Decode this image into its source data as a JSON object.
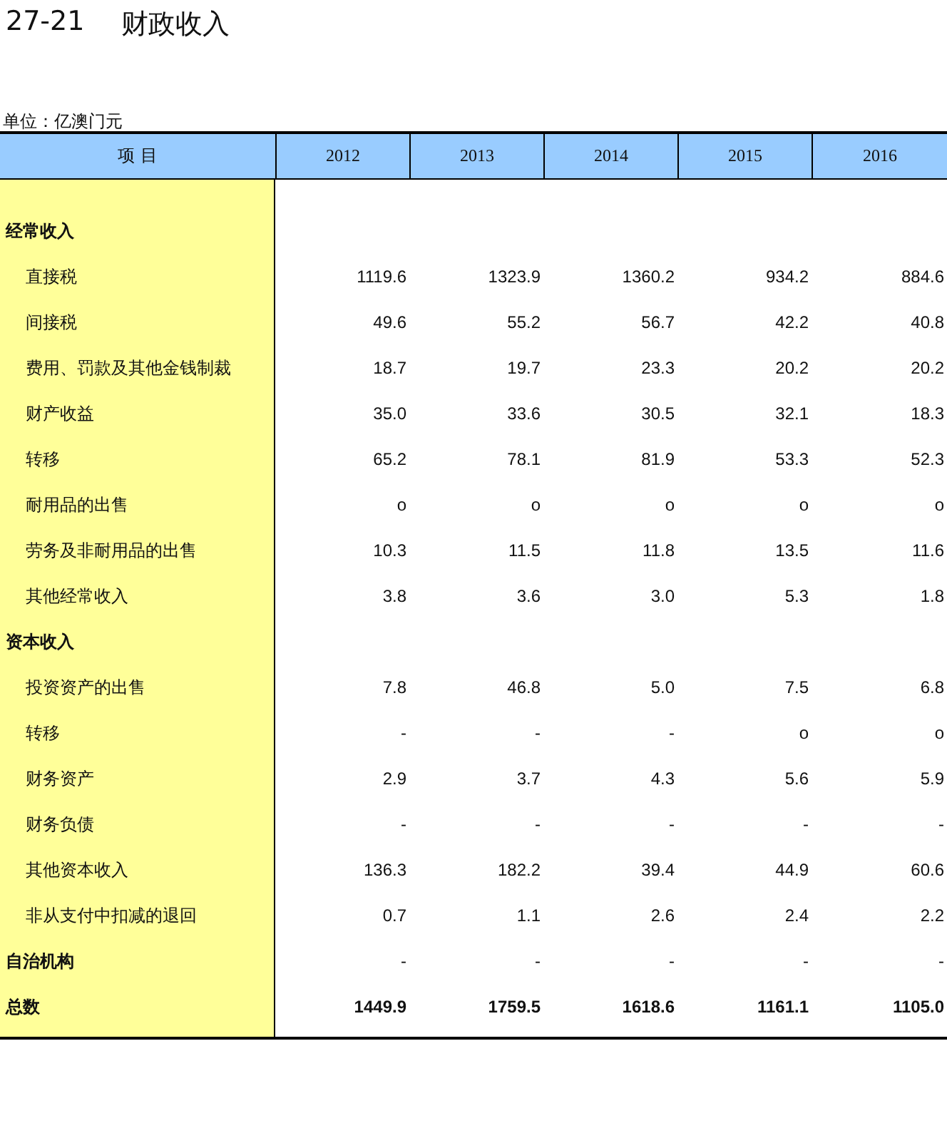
{
  "title": {
    "number": "27-21",
    "text": "财政收入"
  },
  "unit": "单位：亿澳门元",
  "table": {
    "columns": [
      {
        "label": "项 目"
      },
      {
        "label": "2012"
      },
      {
        "label": "2013"
      },
      {
        "label": "2014"
      },
      {
        "label": "2015"
      },
      {
        "label": "2016"
      }
    ],
    "rows": [
      {
        "kind": "section",
        "label": "经常收入"
      },
      {
        "kind": "item",
        "label": "直接税",
        "values": [
          "1119.6",
          "1323.9",
          "1360.2",
          "934.2",
          "884.6"
        ]
      },
      {
        "kind": "item",
        "label": "间接税",
        "values": [
          "49.6",
          "55.2",
          "56.7",
          "42.2",
          "40.8"
        ]
      },
      {
        "kind": "item",
        "label": "费用、罚款及其他金钱制裁",
        "values": [
          "18.7",
          "19.7",
          "23.3",
          "20.2",
          "20.2"
        ]
      },
      {
        "kind": "item",
        "label": "财产收益",
        "values": [
          "35.0",
          "33.6",
          "30.5",
          "32.1",
          "18.3"
        ]
      },
      {
        "kind": "item",
        "label": "转移",
        "values": [
          "65.2",
          "78.1",
          "81.9",
          "53.3",
          "52.3"
        ]
      },
      {
        "kind": "item",
        "label": "耐用品的出售",
        "values": [
          "o",
          "o",
          "o",
          "o",
          "o"
        ]
      },
      {
        "kind": "item",
        "label": "劳务及非耐用品的出售",
        "values": [
          "10.3",
          "11.5",
          "11.8",
          "13.5",
          "11.6"
        ]
      },
      {
        "kind": "item",
        "label": "其他经常收入",
        "values": [
          "3.8",
          "3.6",
          "3.0",
          "5.3",
          "1.8"
        ]
      },
      {
        "kind": "section",
        "label": "资本收入"
      },
      {
        "kind": "item",
        "label": "投资资产的出售",
        "values": [
          "7.8",
          "46.8",
          "5.0",
          "7.5",
          "6.8"
        ]
      },
      {
        "kind": "item",
        "label": "转移",
        "values": [
          "-",
          "-",
          "-",
          "o",
          "o"
        ]
      },
      {
        "kind": "item",
        "label": "财务资产",
        "values": [
          "2.9",
          "3.7",
          "4.3",
          "5.6",
          "5.9"
        ]
      },
      {
        "kind": "item",
        "label": "财务负债",
        "values": [
          "-",
          "-",
          "-",
          "-",
          "-"
        ]
      },
      {
        "kind": "item",
        "label": "其他资本收入",
        "values": [
          "136.3",
          "182.2",
          "39.4",
          "44.9",
          "60.6"
        ]
      },
      {
        "kind": "item",
        "label": "非从支付中扣减的退回",
        "values": [
          "0.7",
          "1.1",
          "2.6",
          "2.4",
          "2.2"
        ]
      },
      {
        "kind": "section",
        "label": "自治机构",
        "values": [
          "-",
          "-",
          "-",
          "-",
          "-"
        ]
      },
      {
        "kind": "total",
        "label": "总数",
        "values": [
          "1449.9",
          "1759.5",
          "1618.6",
          "1161.1",
          "1105.0"
        ]
      }
    ]
  }
}
